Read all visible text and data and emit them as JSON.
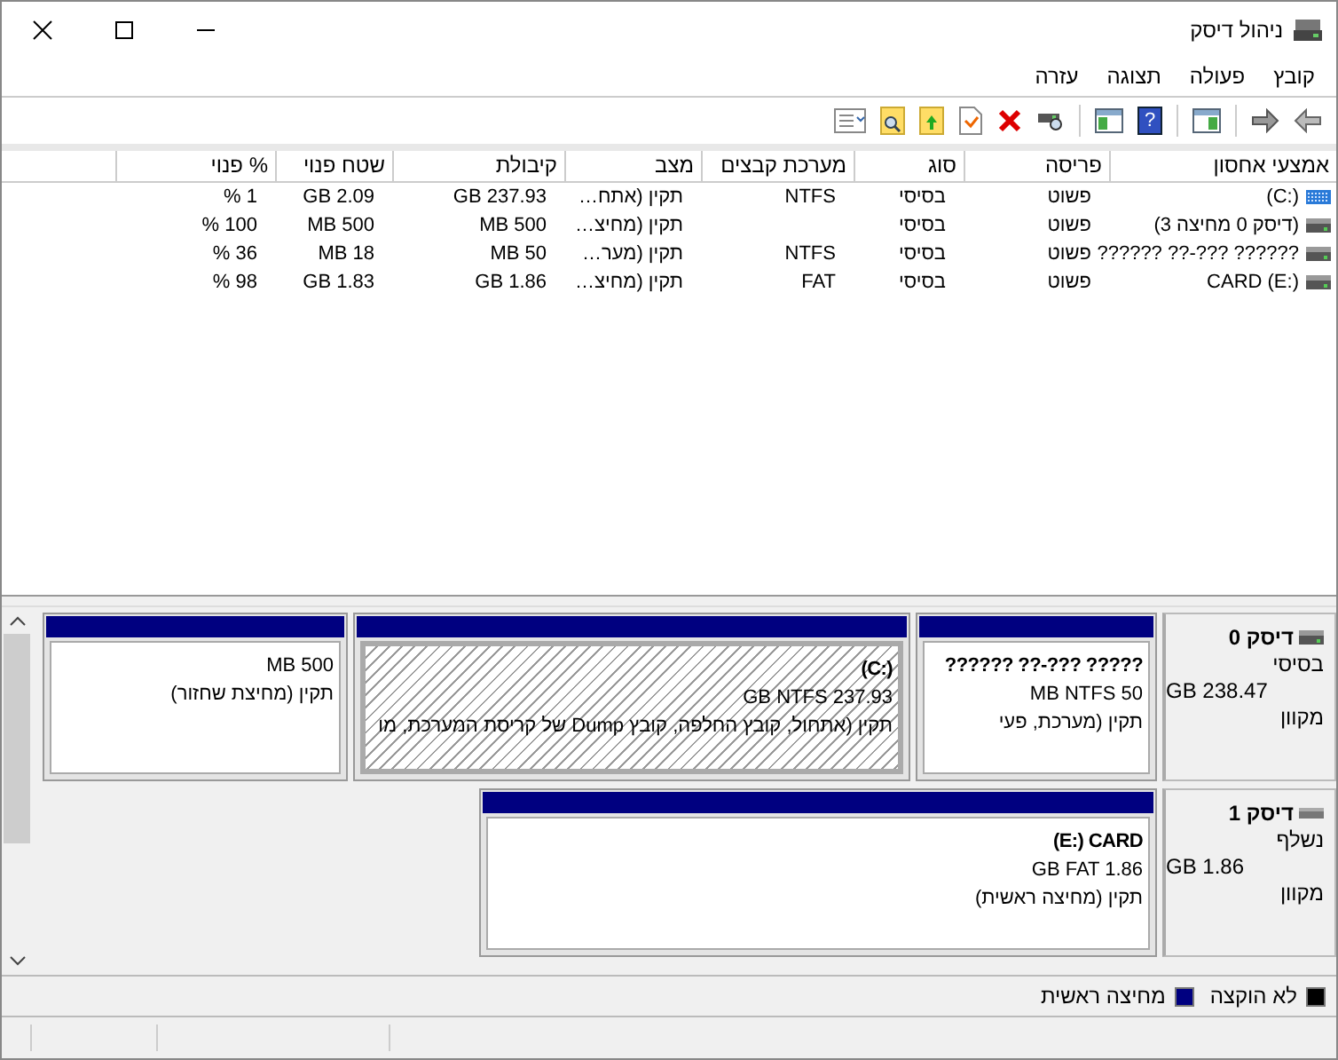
{
  "window": {
    "title": "ניהול דיסק"
  },
  "menu": [
    "קובץ",
    "פעולה",
    "תצוגה",
    "עזרה"
  ],
  "toolbar": {
    "help_label": "?"
  },
  "table": {
    "columns": [
      "אמצעי אחסון",
      "פריסה",
      "סוג",
      "מערכת קבצים",
      "מצב",
      "קיבולת",
      "שטח פנוי",
      "% פנוי"
    ],
    "rows": [
      {
        "kind": "boot",
        "volume": "(C:)",
        "layout": "פשוט",
        "type": "בסיסי",
        "file_system": "NTFS",
        "status": "תקין (אתח…",
        "capacity": "GB 237.93",
        "free_space": "GB 2.09",
        "percent_free": "% 1"
      },
      {
        "kind": "drive",
        "volume": "(דיסק 0 מחיצה 3)",
        "layout": "פשוט",
        "type": "בסיסי",
        "status": "תקין (מחיצ…",
        "capacity": "MB 500",
        "free_space": "MB 500",
        "percent_free": "% 100"
      },
      {
        "kind": "drive",
        "volume": "?????? ??-??? ??????",
        "layout": "פשוט",
        "type": "בסיסי",
        "file_system": "NTFS",
        "status": "תקין (מער…",
        "capacity": "MB 50",
        "free_space": "MB 18",
        "percent_free": "% 36"
      },
      {
        "kind": "drive",
        "volume": "CARD (E:)",
        "layout": "פשוט",
        "type": "בסיסי",
        "file_system": "FAT",
        "status": "תקין (מחיצ…",
        "capacity": "GB 1.86",
        "free_space": "GB 1.83",
        "percent_free": "% 98"
      }
    ]
  },
  "disks": [
    {
      "kind": "fixed",
      "name": "דיסק 0",
      "type": "בסיסי",
      "size": "GB 238.47",
      "status": "מקוון",
      "partitions": [
        {
          "title": "?????? ??-??? ?????",
          "size": "MB NTFS 50",
          "status": "תקין (מערכת, פעי",
          "selected": false
        },
        {
          "title": "(C:)",
          "size": "GB NTFS 237.93",
          "status": "תקין (אתחול, קובץ החלפה, קובץ Dump של קריסת המערכת, מו",
          "selected": true
        },
        {
          "size": "MB 500",
          "status": "תקין (מחיצת שחזור)",
          "selected": false
        }
      ]
    },
    {
      "kind": "removable",
      "name": "דיסק 1",
      "type": "נשלף",
      "size": "GB 1.86",
      "status": "מקוון",
      "partitions": [
        {
          "title": "(E:)  CARD",
          "size": "GB FAT 1.86",
          "status": "תקין (מחיצה ראשית)",
          "selected": false
        }
      ]
    }
  ],
  "legend": [
    {
      "label": "לא הוקצה",
      "color": "#000000"
    },
    {
      "label": "מחיצה ראשית",
      "color": "#000080"
    }
  ]
}
